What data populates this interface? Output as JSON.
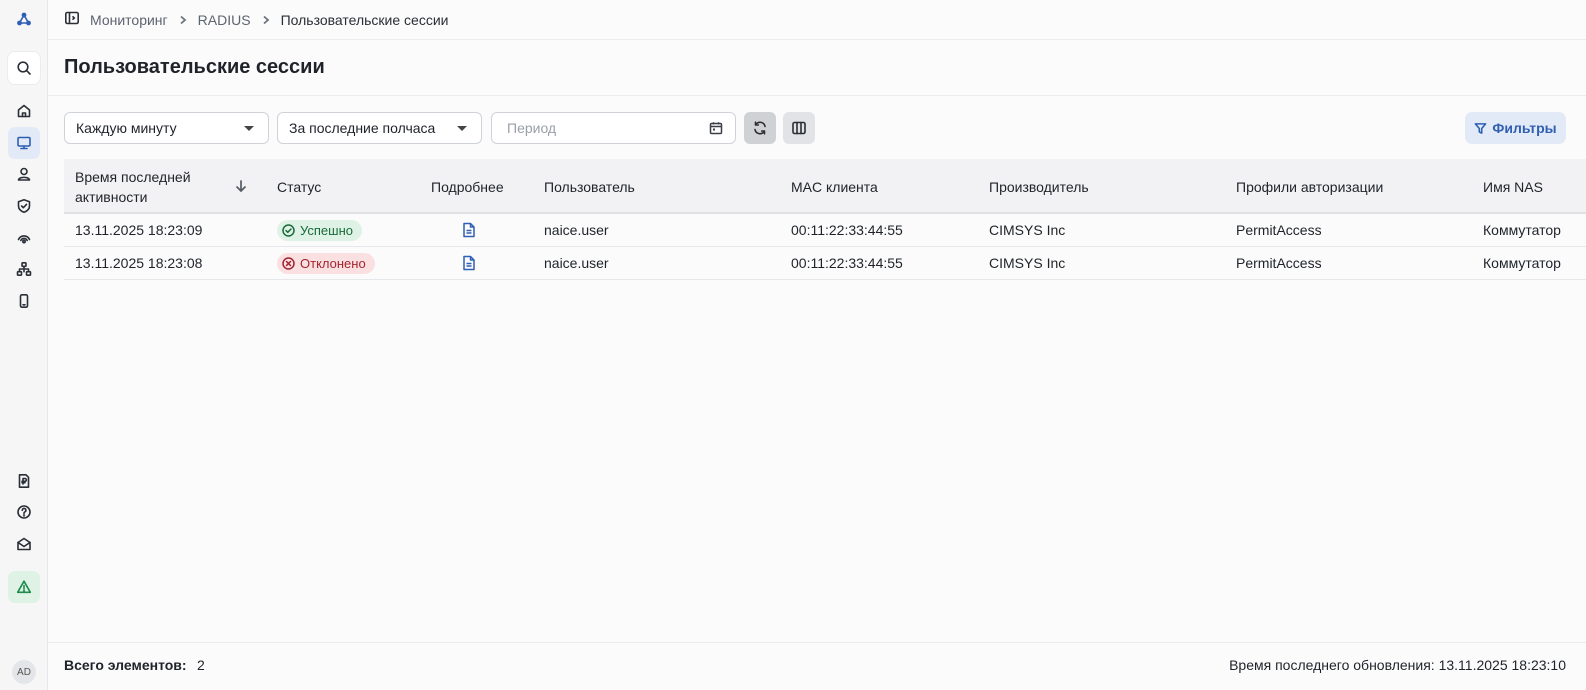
{
  "breadcrumb": {
    "items": [
      "Мониторинг",
      "RADIUS",
      "Пользовательские сессии"
    ]
  },
  "page": {
    "title": "Пользовательские сессии"
  },
  "toolbar": {
    "refresh_interval": "Каждую минуту",
    "time_range": "За последние полчаса",
    "period_placeholder": "Период",
    "filters_label": "Фильтры"
  },
  "table": {
    "columns": [
      "Время последней активности",
      "Статус",
      "Подробнее",
      "Пользователь",
      "MAC клиента",
      "Производитель",
      "Профили авторизации",
      "Имя NAS"
    ],
    "rows": [
      {
        "time": "13.11.2025 18:23:09",
        "status": "Успешно",
        "user": "naice.user",
        "mac": "00:11:22:33:44:55",
        "vendor": "CIMSYS Inc",
        "profile": "PermitAccess",
        "nas": "Коммутатор"
      },
      {
        "time": "13.11.2025 18:23:08",
        "status": "Отклонено",
        "user": "naice.user",
        "mac": "00:11:22:33:44:55",
        "vendor": "CIMSYS Inc",
        "profile": "PermitAccess",
        "nas": "Коммутатор"
      }
    ]
  },
  "footer": {
    "total_label": "Всего элементов:",
    "total_value": "2",
    "last_update": "Время последнего обновления: 13.11.2025 18:23:10"
  },
  "user": {
    "initials": "AD"
  },
  "colors": {
    "accent": "#2f5fb3",
    "success": "#1a6b3a",
    "danger": "#a3242f"
  }
}
